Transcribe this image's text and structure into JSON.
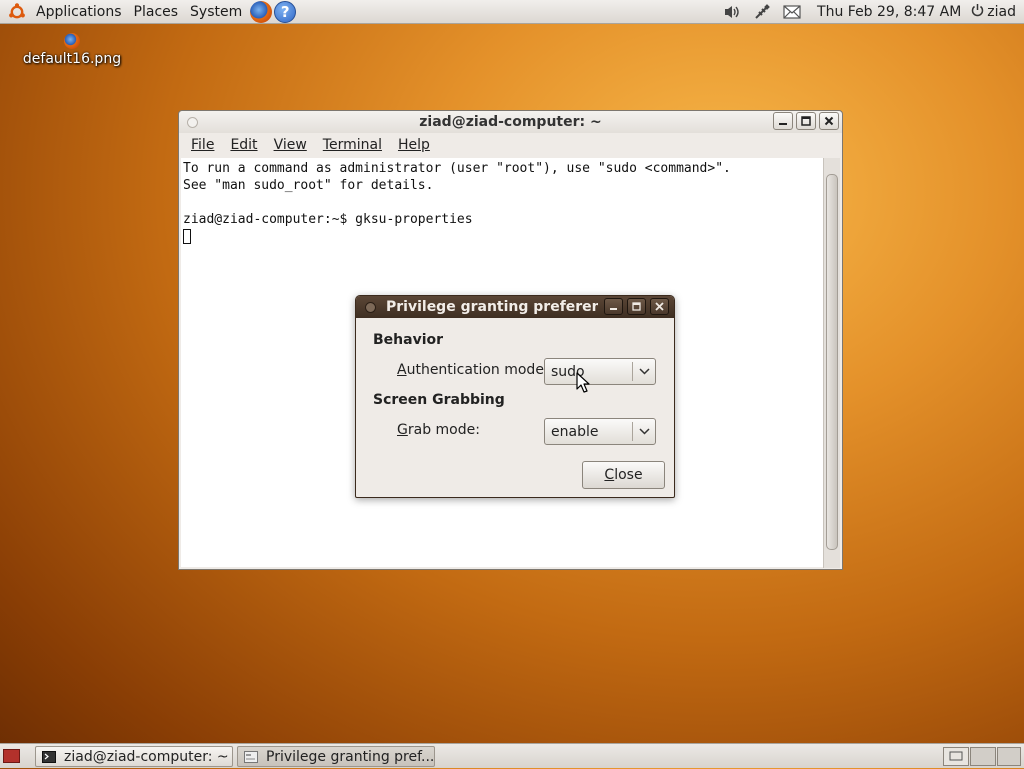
{
  "top_panel": {
    "menus": [
      "Applications",
      "Places",
      "System"
    ],
    "clock": "Thu Feb 29,  8:47 AM",
    "user": "ziad"
  },
  "desktop": {
    "icon_label": "default16.png"
  },
  "terminal": {
    "title": "ziad@ziad-computer: ~",
    "menu": [
      "File",
      "Edit",
      "View",
      "Terminal",
      "Help"
    ],
    "lines": [
      "To run a command as administrator (user \"root\"), use \"sudo <command>\".",
      "See \"man sudo_root\" for details.",
      "",
      "ziad@ziad-computer:~$ gksu-properties"
    ]
  },
  "dialog": {
    "title": "Privilege granting preferen",
    "behavior_heading": "Behavior",
    "auth_label_accel": "A",
    "auth_label_rest": "uthentication mode:",
    "auth_value": "sudo",
    "grab_heading": "Screen Grabbing",
    "grab_label_accel": "G",
    "grab_label_rest": "rab mode:",
    "grab_value": "enable",
    "close_accel": "C",
    "close_rest": "lose"
  },
  "taskbar": {
    "tasks": [
      "ziad@ziad-computer: ~",
      "Privilege granting pref..."
    ]
  },
  "icons": {
    "top_panel": [
      "ubuntu-logo-icon",
      "firefox-icon",
      "help-icon",
      "volume-icon",
      "network-icon",
      "mail-icon",
      "power-icon"
    ],
    "taskbar": [
      "show-desktop-icon",
      "terminal-icon",
      "dialog-icon"
    ]
  },
  "colors": {
    "desktop_accent": "#e4912a",
    "dialog_titlebar": "#4b392b",
    "show_desktop": "#b3312b"
  }
}
